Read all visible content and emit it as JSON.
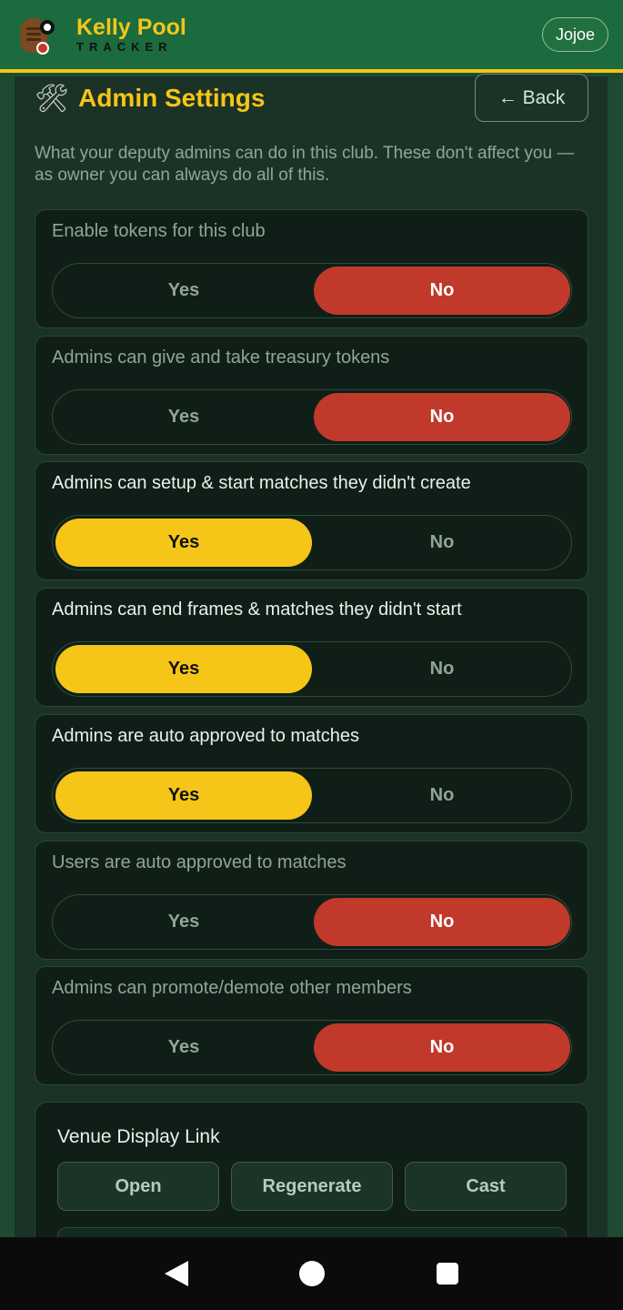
{
  "header": {
    "brand_title": "Kelly Pool",
    "brand_subtitle": "TRACKER",
    "user_label": "Jojoe"
  },
  "page": {
    "title": "Admin Settings",
    "icon": "hammer-wrench-icon",
    "back_label": "← Back",
    "intro": "What your deputy admins can do in this club. These don't affect you — as owner you can always do all of this."
  },
  "settings": [
    {
      "label": "Enable tokens for this club",
      "yes": "Yes",
      "no": "No",
      "value": "No"
    },
    {
      "label": "Admins can give and take treasury tokens",
      "yes": "Yes",
      "no": "No",
      "value": "No"
    },
    {
      "label": "Admins can setup & start matches they didn't create",
      "yes": "Yes",
      "no": "No",
      "value": "Yes"
    },
    {
      "label": "Admins can end frames & matches they didn't start",
      "yes": "Yes",
      "no": "No",
      "value": "Yes"
    },
    {
      "label": "Admins are auto approved to matches",
      "yes": "Yes",
      "no": "No",
      "value": "Yes"
    },
    {
      "label": "Users are auto approved to matches",
      "yes": "Yes",
      "no": "No",
      "value": "No"
    },
    {
      "label": "Admins can promote/demote other members",
      "yes": "Yes",
      "no": "No",
      "value": "No"
    }
  ],
  "venue": {
    "title": "Venue Display Link",
    "open_label": "Open",
    "regenerate_label": "Regenerate",
    "cast_label": "Cast"
  },
  "colors": {
    "header_bg": "#1b6b3e",
    "accent_yellow": "#f5c518",
    "no_red": "#c0392b"
  }
}
